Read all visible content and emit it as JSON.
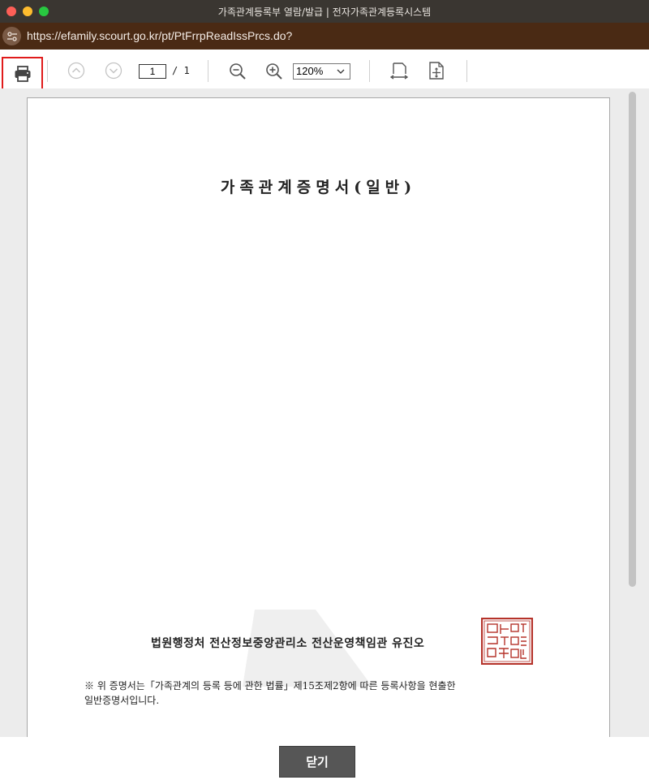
{
  "window": {
    "title": "가족관계등록부 열람/발급 | 전자가족관계등록시스템"
  },
  "urlbar": {
    "url": "https://efamily.scourt.go.kr/pt/PtFrrpReadIssPrcs.do?"
  },
  "toolbar": {
    "print_icon": "printer-icon",
    "prev_icon": "chevron-up-circle-icon",
    "next_icon": "chevron-down-circle-icon",
    "page_current": "1",
    "page_total": "/ 1",
    "zoom_out_icon": "zoom-out-icon",
    "zoom_in_icon": "zoom-in-icon",
    "zoom_value": "120%",
    "fit_width_icon": "fit-width-icon",
    "fit_page_icon": "fit-page-icon",
    "highlight_color": "#e01b1b"
  },
  "document": {
    "title": "가족관계증명서(일반)",
    "issuer": "법원행정처 전산정보중앙관리소 전산운영책임관 유진오",
    "note_line1": "※ 위 증명서는「가족관계의 등록 등에 관한 법률」제15조제2항에 따른 등록사항을 현출한",
    "note_line2": "일반증명서입니다.",
    "seal_icon": "official-seal-icon",
    "seal_color": "#b5332a"
  },
  "footer": {
    "close_label": "닫기"
  }
}
